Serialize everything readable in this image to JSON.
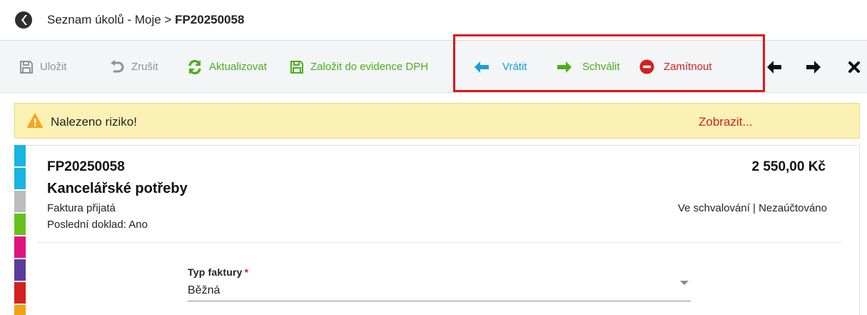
{
  "breadcrumb": {
    "path": "Seznam úkolů - Moje > ",
    "current": "FP20250058"
  },
  "toolbar": {
    "save_label": "Uložit",
    "cancel_label": "Zrušit",
    "refresh_label": "Aktualizovat",
    "vat_label": "Založit do evidence DPH",
    "return_label": "Vrátit",
    "approve_label": "Schválit",
    "reject_label": "Zamítnout"
  },
  "risk": {
    "message": "Nalezeno riziko!",
    "link": "Zobrazit..."
  },
  "document": {
    "number": "FP20250058",
    "amount": "2 550,00 Kč",
    "title": "Kancelářské potřeby",
    "type": "Faktura přijatá",
    "last_doc": "Poslední doklad: Ano",
    "status": "Ve schvalování | Nezaúčtováno"
  },
  "form": {
    "invoice_type_label": "Typ faktury",
    "required_mark": "*",
    "invoice_type_value": "Běžná"
  },
  "colors": {
    "accent_green": "#4cae1c",
    "accent_blue": "#1a9fd8",
    "accent_red": "#d42020",
    "warning_bg": "#fcf1b4",
    "stripes": [
      "#17b5e0",
      "#17b5e0",
      "#bdbdbd",
      "#66c21b",
      "#e0137b",
      "#5b3b9a",
      "#d42020",
      "#f3a012"
    ]
  }
}
